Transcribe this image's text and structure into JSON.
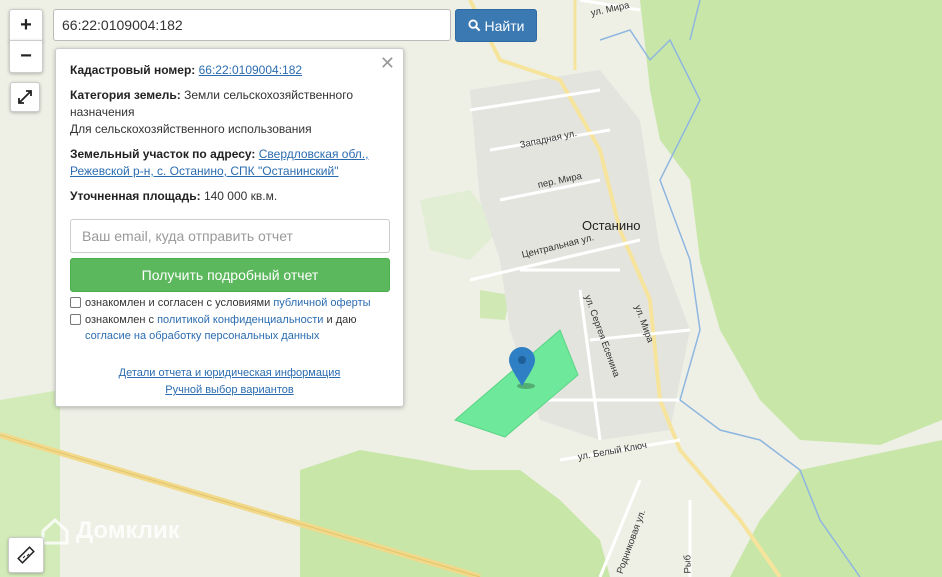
{
  "search": {
    "value": "66:22:0109004:182",
    "button_label": "Найти"
  },
  "controls": {
    "zoom_in": "+",
    "zoom_out": "−"
  },
  "popup": {
    "cadastral_label": "Кадастровый номер:",
    "cadastral_value": "66:22:0109004:182",
    "category_label": "Категория земель:",
    "category_value": "Земли сельскохозяйственного назначения",
    "usage_value": "Для сельскохозяйственного использования",
    "address_label": "Земельный участок по адресу:",
    "address_value": "Свердловская обл., Режевской р-н, с. Останино, СПК \"Останинский\"",
    "area_label": "Уточненная площадь:",
    "area_value": "140 000 кв.м.",
    "email_placeholder": "Ваш email, куда отправить отчет",
    "report_button": "Получить подробный отчет",
    "agree1_text": "ознакомлен и согласен с условиями",
    "agree1_link": "публичной оферты",
    "agree2_text": "ознакомлен с",
    "agree2_link": "политикой конфиденциальности",
    "agree2_text2": "и даю",
    "agree2_link2": "согласие на обработку персональных данных",
    "details_link": "Детали отчета и юридическая информация",
    "manual_link": "Ручной выбор вариантов"
  },
  "map": {
    "town": "Останино",
    "streets": {
      "mira_top": "ул. Мира",
      "zapadnaya": "Западная ул.",
      "per_mira": "пер. Мира",
      "centralnaya": "Центральная ул.",
      "esenina": "ул. Сергея Есенина",
      "mira_mid": "ул. Мира",
      "beliy_klyuch": "ул. Белый Ключ",
      "rodnikovaya": "Родниковая ул.",
      "ryb": "Рыб"
    },
    "watermark": "Домклик",
    "colors": {
      "parcel": "#6ee89a",
      "marker": "#2f7fc4",
      "forest": "#c8e6a8",
      "road_major": "#f2d98a"
    }
  }
}
